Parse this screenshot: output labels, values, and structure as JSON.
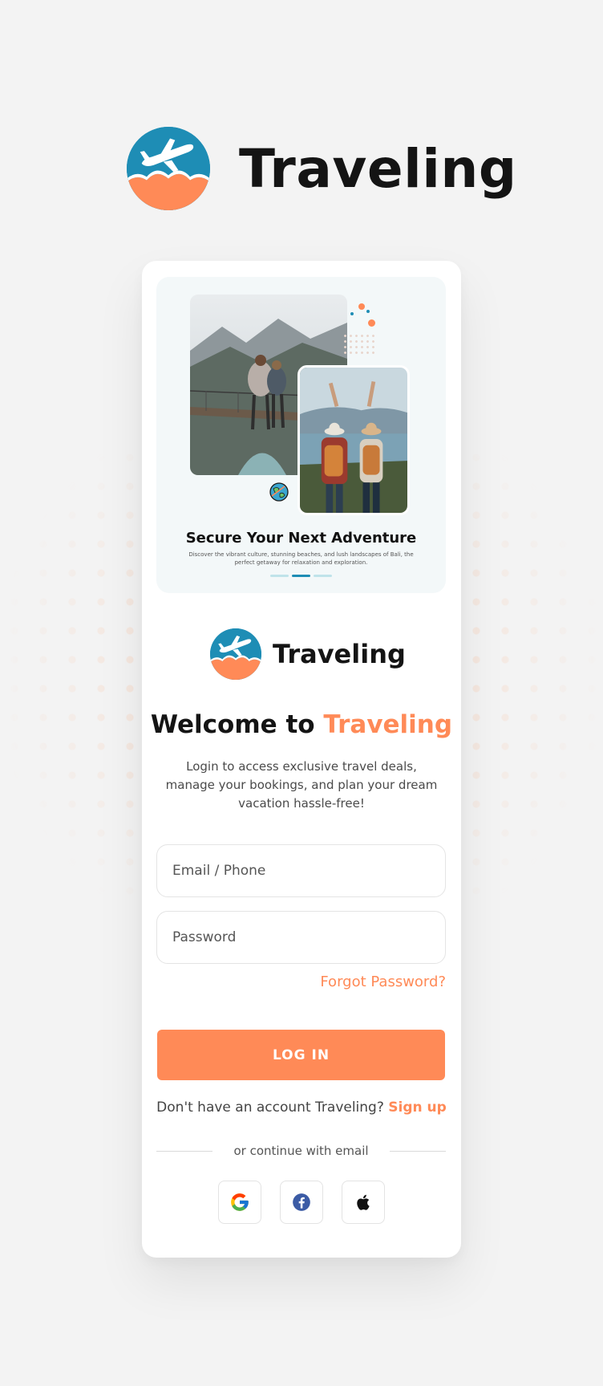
{
  "brand": {
    "name": "Traveling"
  },
  "colors": {
    "accent": "#ff8a57",
    "primary": "#1e8db5",
    "text": "#141414",
    "background": "#f3f3f3"
  },
  "hero": {
    "title": "Secure Your Next Adventure",
    "description": "Discover the vibrant culture, stunning beaches, and lush landscapes of Bali, the perfect getaway for relaxation and exploration.",
    "slides": 3,
    "active_slide": 2
  },
  "welcome": {
    "prefix": "Welcome to",
    "highlight": "Traveling"
  },
  "subtitle": "Login to access exclusive travel deals, manage your bookings, and plan your dream vacation hassle-free!",
  "form": {
    "email_placeholder": "Email / Phone",
    "password_placeholder": "Password",
    "forgot_label": "Forgot Password?",
    "login_label": "LOG IN"
  },
  "signup": {
    "prompt": "Don't have an account Traveling?",
    "link_label": "Sign up"
  },
  "divider_text": "or continue with email",
  "social_icons": [
    "google-icon",
    "facebook-icon",
    "apple-icon"
  ]
}
